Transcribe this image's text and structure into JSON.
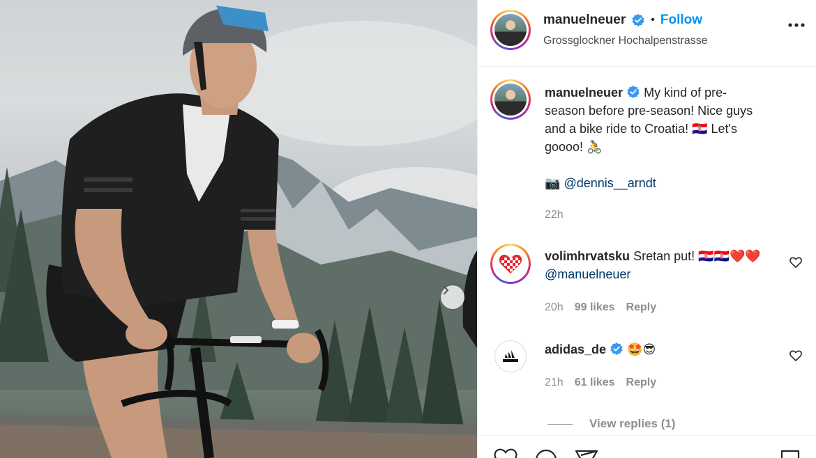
{
  "post": {
    "username": "manuelneuer",
    "follow_label": "Follow",
    "separator": "•",
    "location": "Grossglockner Hochalpenstrasse"
  },
  "caption": {
    "username": "manuelneuer",
    "line1": "My kind of pre-",
    "line2": "season before pre-season! Nice guys",
    "line3": "and a bike ride to Croatia! 🇭🇷 Let's",
    "line4": "goooo! 🚴",
    "credit_icon": "📷",
    "credit_mention": "@dennis__arndt",
    "time": "22h"
  },
  "comments": [
    {
      "username": "volimhrvatsku",
      "text": "Sretan put! 🇭🇷🇭🇷❤️❤️",
      "mention": "@manuelneuer",
      "time": "20h",
      "likes": "99 likes",
      "reply_label": "Reply"
    },
    {
      "username": "adidas_de",
      "text": "🤩😎",
      "time": "21h",
      "likes": "61 likes",
      "reply_label": "Reply"
    }
  ],
  "view_replies": "View replies (1)",
  "icons": {
    "verified": "verified-badge-icon",
    "more": "more-options-icon",
    "heart": "heart-icon",
    "comment": "comment-icon",
    "share": "share-icon",
    "save": "bookmark-icon",
    "next": "chevron-right-icon"
  },
  "colors": {
    "follow": "#0095f6",
    "verified": "#3897f0",
    "mention": "#00376b",
    "muted": "#8e8e8e"
  }
}
